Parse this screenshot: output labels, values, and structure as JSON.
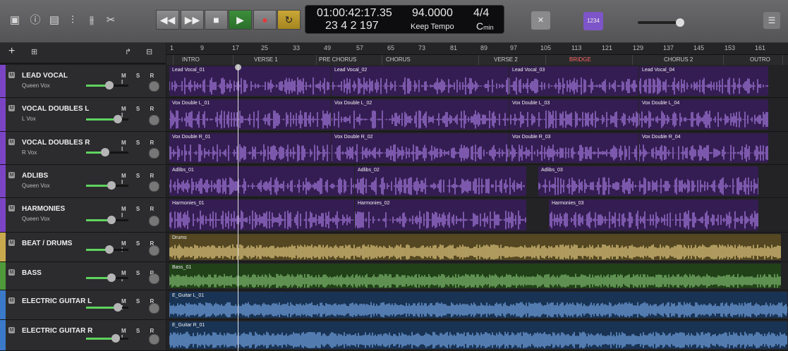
{
  "toolbar": {
    "left_icons": [
      "media-browser-icon",
      "info-icon",
      "screen-icon",
      "mixer-icon",
      "eq-icon",
      "scissors-icon"
    ],
    "transport": {
      "rewind": "◀◀",
      "forward": "▶▶",
      "stop": "■",
      "play": "▶",
      "record": "●",
      "cycle": "↻"
    },
    "count_in_label": "1234",
    "right_close": "✕"
  },
  "lcd": {
    "time": "01:00:42:17.35",
    "bars": "23  4  2  197",
    "tempo": "94.0000",
    "tempo_mode": "Keep Tempo",
    "signature": "4/4",
    "key_root": "C",
    "key_mode": "min"
  },
  "ruler": {
    "bars": [
      "1",
      "9",
      "17",
      "25",
      "33",
      "49",
      "57",
      "65",
      "73",
      "81",
      "89",
      "97",
      "105",
      "113",
      "121",
      "129",
      "137",
      "145",
      "153",
      "161"
    ]
  },
  "markers": [
    {
      "label": "INTRO",
      "color": "#ccc"
    },
    {
      "label": "VERSE 1",
      "color": "#ccc"
    },
    {
      "label": "PRE CHORUS",
      "color": "#ccc"
    },
    {
      "label": "CHORUS",
      "color": "#ccc"
    },
    {
      "label": "VERSE 2",
      "color": "#ccc"
    },
    {
      "label": "BRIDGE",
      "color": "#ff6666"
    },
    {
      "label": "CHORUS 2",
      "color": "#ccc"
    },
    {
      "label": "OUTRO",
      "color": "#ccc"
    }
  ],
  "tracks": [
    {
      "name": "LEAD VOCAL",
      "sub": "Queen Vox",
      "color": "#7b44c4",
      "fader": 0.55,
      "msri": "M S R I",
      "regions": [
        {
          "label": "Lead Vocal_01"
        },
        {
          "label": "Lead Vocal_02"
        },
        {
          "label": "Lead Vocal_03"
        },
        {
          "label": "Lead Vocal_04"
        }
      ]
    },
    {
      "name": "VOCAL DOUBLES L",
      "sub": "L Vox",
      "color": "#7b44c4",
      "fader": 0.75,
      "msri": "M S R I",
      "regions": [
        {
          "label": "Vox Double L_01"
        },
        {
          "label": "Vox Double L_02"
        },
        {
          "label": "Vox Double L_03"
        },
        {
          "label": "Vox Double L_04"
        }
      ]
    },
    {
      "name": "VOCAL DOUBLES R",
      "sub": "R Vox",
      "color": "#7b44c4",
      "fader": 0.45,
      "msri": "M S R I",
      "regions": [
        {
          "label": "Vox Double R_01"
        },
        {
          "label": "Vox Double R_02"
        },
        {
          "label": "Vox Double R_03"
        },
        {
          "label": "Vox Double R_04"
        }
      ]
    },
    {
      "name": "ADLIBS",
      "sub": "Queen Vox",
      "color": "#7b44c4",
      "fader": 0.6,
      "msri": "M S R I",
      "regions": [
        {
          "label": "Adlibs_01"
        },
        {
          "label": "Adlibs_02"
        },
        {
          "label": "Adlibs_03"
        }
      ]
    },
    {
      "name": "HARMONIES",
      "sub": "Queen Vox",
      "color": "#7b44c4",
      "fader": 0.6,
      "msri": "M S R I",
      "regions": [
        {
          "label": "Harmonies_01"
        },
        {
          "label": "Harmonies_02"
        },
        {
          "label": "Harmonies_03"
        }
      ]
    },
    {
      "name": "BEAT / DRUMS",
      "sub": "",
      "color": "#c9a94e",
      "fader": 0.55,
      "msri": "M S R I",
      "regions": [
        {
          "label": "Drums"
        }
      ]
    },
    {
      "name": "BASS",
      "sub": "",
      "color": "#4e9a3a",
      "fader": 0.6,
      "msri": "M S R I",
      "regions": [
        {
          "label": "Bass_01"
        }
      ]
    },
    {
      "name": "ELECTRIC GUITAR L",
      "sub": "",
      "color": "#3b79c9",
      "fader": 0.75,
      "msri": "M S R I",
      "regions": [
        {
          "label": "E_Guitar L_01"
        }
      ]
    },
    {
      "name": "ELECTRIC GUITAR R",
      "sub": "",
      "color": "#3b79c9",
      "fader": 0.7,
      "msri": "M S R I",
      "regions": [
        {
          "label": "E_Guitar R_01"
        }
      ]
    }
  ]
}
